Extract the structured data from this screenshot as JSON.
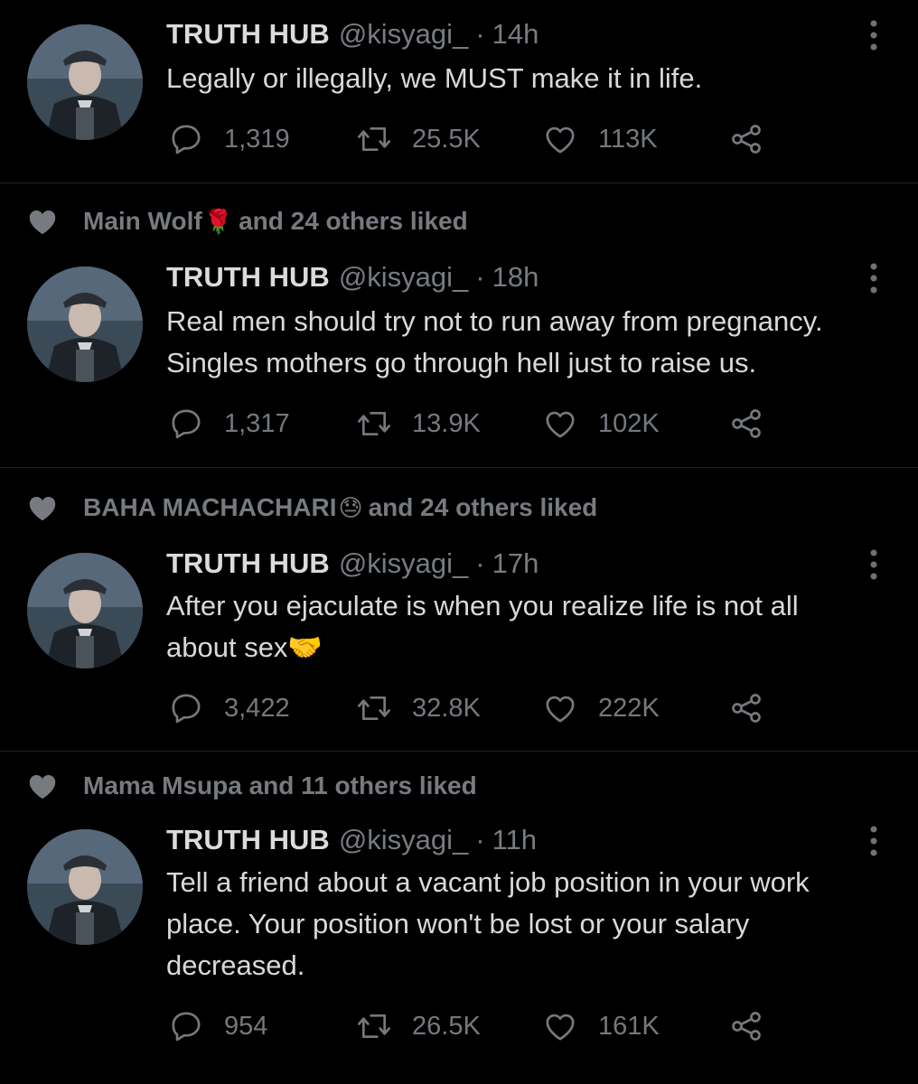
{
  "tweets": [
    {
      "social_context": null,
      "author": {
        "name": "TRUTH HUB",
        "handle": "@kisyagi_"
      },
      "separator": "·",
      "time": "14h",
      "lines": [
        "Legally or illegally, we MUST make it in life."
      ],
      "stats": {
        "replies": "1,319",
        "retweets": "25.5K",
        "likes": "113K"
      }
    },
    {
      "social_context": {
        "lead": "Main Wolf",
        "emoji": "🌹",
        "rest": "and 24 others liked"
      },
      "author": {
        "name": "TRUTH HUB",
        "handle": "@kisyagi_"
      },
      "separator": "·",
      "time": "18h",
      "lines": [
        "Real men should try not to run away from pregnancy.",
        "Singles mothers go through hell just to raise us."
      ],
      "stats": {
        "replies": "1,317",
        "retweets": "13.9K",
        "likes": "102K"
      }
    },
    {
      "social_context": {
        "lead": "BAHA MACHACHARI",
        "emoji": "😓",
        "rest": "and 24 others liked"
      },
      "author": {
        "name": "TRUTH HUB",
        "handle": "@kisyagi_"
      },
      "separator": "·",
      "time": "17h",
      "lines": [
        "After you ejaculate is when you realize life is not all",
        "about sex🤝"
      ],
      "stats": {
        "replies": "3,422",
        "retweets": "32.8K",
        "likes": "222K"
      }
    },
    {
      "social_context": {
        "lead": "Mama Msupa and 11 others liked",
        "emoji": "",
        "rest": ""
      },
      "author": {
        "name": "TRUTH HUB",
        "handle": "@kisyagi_"
      },
      "separator": "·",
      "time": "11h",
      "lines": [
        "Tell a friend about a vacant job position in your work",
        "place. Your position won't be lost or your salary",
        "decreased."
      ],
      "stats": {
        "replies": "954",
        "retweets": "26.5K",
        "likes": "161K"
      }
    }
  ],
  "colors": {
    "background": "#000000",
    "muted": "#787c81",
    "text": "#d7d9db",
    "divider": "#1e2124"
  },
  "icons": [
    "heart-icon",
    "reply-icon",
    "retweet-icon",
    "like-icon",
    "share-icon",
    "more-options-icon"
  ]
}
